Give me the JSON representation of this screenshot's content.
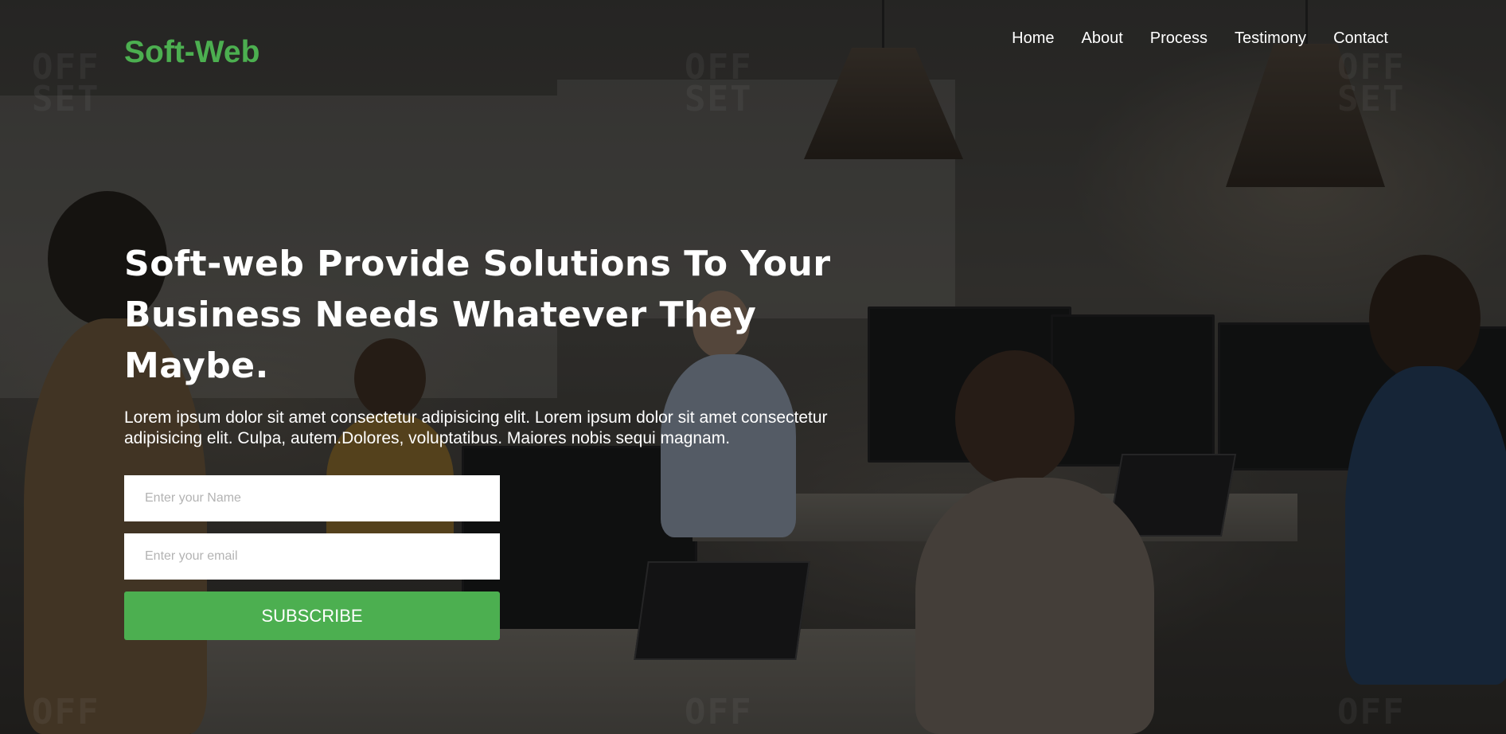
{
  "brand": {
    "name": "Soft-Web",
    "color": "#4caf50"
  },
  "nav": {
    "items": [
      {
        "label": "Home"
      },
      {
        "label": "About"
      },
      {
        "label": "Process"
      },
      {
        "label": "Testimony"
      },
      {
        "label": "Contact"
      }
    ]
  },
  "hero": {
    "title": "Soft-web Provide Solutions To Your Business Needs Whatever They Maybe.",
    "description": "Lorem ipsum dolor sit amet consectetur adipisicing elit. Lorem ipsum dolor sit amet consectetur adipisicing elit. Culpa, autem.Dolores, voluptatibus. Maiores nobis sequi magnam.",
    "background_image": "office-team-meeting-photo",
    "watermark_text": "OFFSET"
  },
  "form": {
    "name_placeholder": "Enter your Name",
    "name_value": "",
    "email_placeholder": "Enter your email",
    "email_value": "",
    "submit_label": "SUBSCRIBE",
    "submit_color": "#4caf50"
  }
}
